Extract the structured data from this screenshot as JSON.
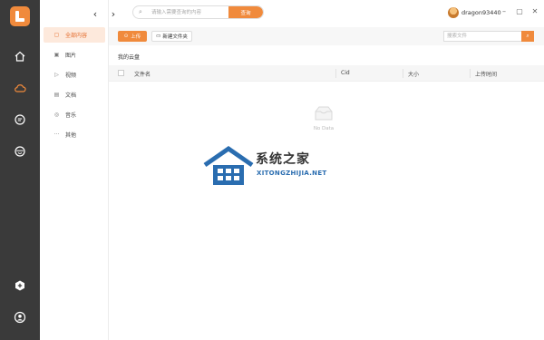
{
  "sidebar": {
    "items": [
      "home-icon",
      "cloud-icon",
      "chat-icon",
      "smile-icon"
    ],
    "bottom": [
      "plus-icon",
      "user-icon"
    ]
  },
  "categories": [
    {
      "label": "全部内容",
      "icon": "▢"
    },
    {
      "label": "图片",
      "icon": "▣"
    },
    {
      "label": "视频",
      "icon": "▷"
    },
    {
      "label": "文档",
      "icon": "▤"
    },
    {
      "label": "音乐",
      "icon": "◎"
    },
    {
      "label": "其他",
      "icon": "···"
    }
  ],
  "header": {
    "back": "‹",
    "forward": "›",
    "search_placeholder": "请输入需要查询的内容",
    "search_button": "查询",
    "username": "dragon93440",
    "minimize": "–",
    "maximize": "▢",
    "close": "✕"
  },
  "toolbar": {
    "upload": "上传",
    "new_folder": "新建文件夹",
    "file_search_placeholder": "搜索文件",
    "file_search_icon": "⌕"
  },
  "breadcrumb": "我的云盘",
  "table": {
    "columns": [
      "文件名",
      "Cid",
      "大小",
      "上传时间"
    ]
  },
  "empty_text": "No Data",
  "watermark": {
    "title": "系统之家",
    "url": "XITONGZHIJIA.NET"
  },
  "colors": {
    "accent": "#f08a3c",
    "sidebar": "#3a3a3a",
    "active_bg": "#fde9dc"
  }
}
